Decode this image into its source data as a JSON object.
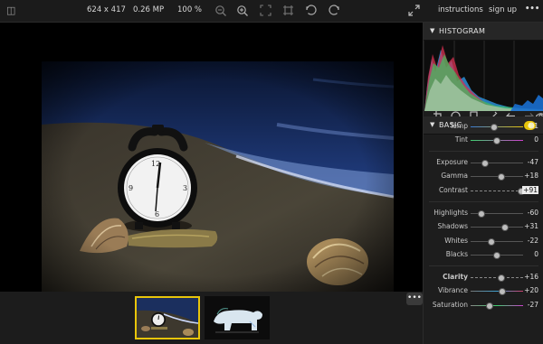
{
  "topbar": {
    "dimensions": "624 x 417",
    "megapixels": "0.26 MP",
    "zoom": "100 %",
    "instructions_link": "instructions",
    "signup_link": "sign up",
    "more_label": "•••"
  },
  "filmstrip": {
    "more_label": "•••",
    "thumbnails": [
      "alarm-clock-beach",
      "polar-bear"
    ],
    "selected_index": 0
  },
  "panel": {
    "histogram_title": "HISTOGRAM",
    "basic_title": "BASIC",
    "sliders": [
      {
        "label": "Temp",
        "value": "-11",
        "level": 0.45
      },
      {
        "label": "Tint",
        "value": "0",
        "level": 0.5
      },
      {
        "label": "Exposure",
        "value": "-47",
        "level": 0.27
      },
      {
        "label": "Gamma",
        "value": "+18",
        "level": 0.59
      },
      {
        "label": "Contrast",
        "value": "+91",
        "level": 0.96
      },
      {
        "label": "Highlights",
        "value": "-60",
        "level": 0.2
      },
      {
        "label": "Shadows",
        "value": "+31",
        "level": 0.66
      },
      {
        "label": "Whites",
        "value": "-22",
        "level": 0.39
      },
      {
        "label": "Blacks",
        "value": "0",
        "level": 0.5
      },
      {
        "label": "Clarity",
        "value": "+16",
        "level": 0.58
      },
      {
        "label": "Vibrance",
        "value": "+20",
        "level": 0.6
      },
      {
        "label": "Saturation",
        "value": "-27",
        "level": 0.36
      }
    ]
  },
  "colors": {
    "accent": "#e8c50a",
    "background": "#131313",
    "panel": "#1d1d1d"
  }
}
